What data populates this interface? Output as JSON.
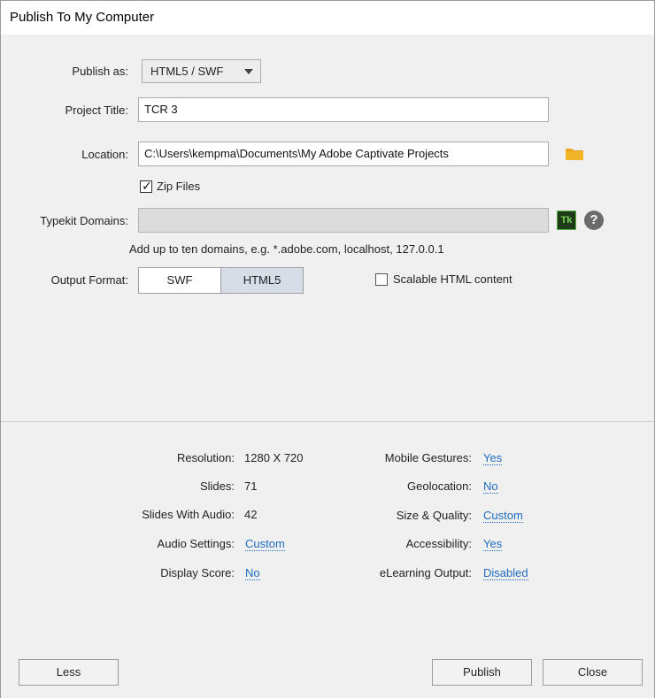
{
  "window": {
    "title": "Publish To My Computer"
  },
  "form": {
    "publish_as_label": "Publish as:",
    "publish_as_value": "HTML5 / SWF",
    "project_title_label": "Project Title:",
    "project_title_value": "TCR 3",
    "location_label": "Location:",
    "location_value": "C:\\Users\\kempma\\Documents\\My Adobe Captivate Projects",
    "zip_files_label": "Zip Files",
    "zip_files_checked": true,
    "typekit_label": "Typekit Domains:",
    "typekit_value": "",
    "typekit_hint": "Add up to ten domains, e.g. *.adobe.com, localhost, 127.0.0.1",
    "typekit_badge": "Tk",
    "help_glyph": "?",
    "output_format_label": "Output Format:",
    "output_formats": [
      "SWF",
      "HTML5"
    ],
    "output_format_selected": "HTML5",
    "scalable_label": "Scalable HTML content",
    "scalable_checked": false
  },
  "summary": {
    "left": [
      {
        "label": "Resolution:",
        "value": "1280 X 720",
        "link": false
      },
      {
        "label": "Slides:",
        "value": "71",
        "link": false
      },
      {
        "label": "Slides With Audio:",
        "value": "42",
        "link": false
      },
      {
        "label": "Audio Settings:",
        "value": "Custom",
        "link": true
      },
      {
        "label": "Display Score:",
        "value": "No",
        "link": true
      }
    ],
    "right": [
      {
        "label": "Mobile Gestures:",
        "value": "Yes",
        "link": true
      },
      {
        "label": "Geolocation:",
        "value": "No",
        "link": true
      },
      {
        "label": "Size & Quality:",
        "value": "Custom",
        "link": true
      },
      {
        "label": "Accessibility:",
        "value": "Yes",
        "link": true
      },
      {
        "label": "eLearning Output:",
        "value": "Disabled",
        "link": true
      }
    ]
  },
  "buttons": {
    "less": "Less",
    "publish": "Publish",
    "close": "Close"
  },
  "colors": {
    "link": "#1f6bbf",
    "segment_selected": "#d6dde6",
    "folder": "#e8a317"
  },
  "icons": {
    "folder": "folder-icon",
    "typekit": "typekit-icon",
    "help": "help-icon",
    "checkmark": "checkmark-icon",
    "dropdown": "chevron-down-icon"
  }
}
